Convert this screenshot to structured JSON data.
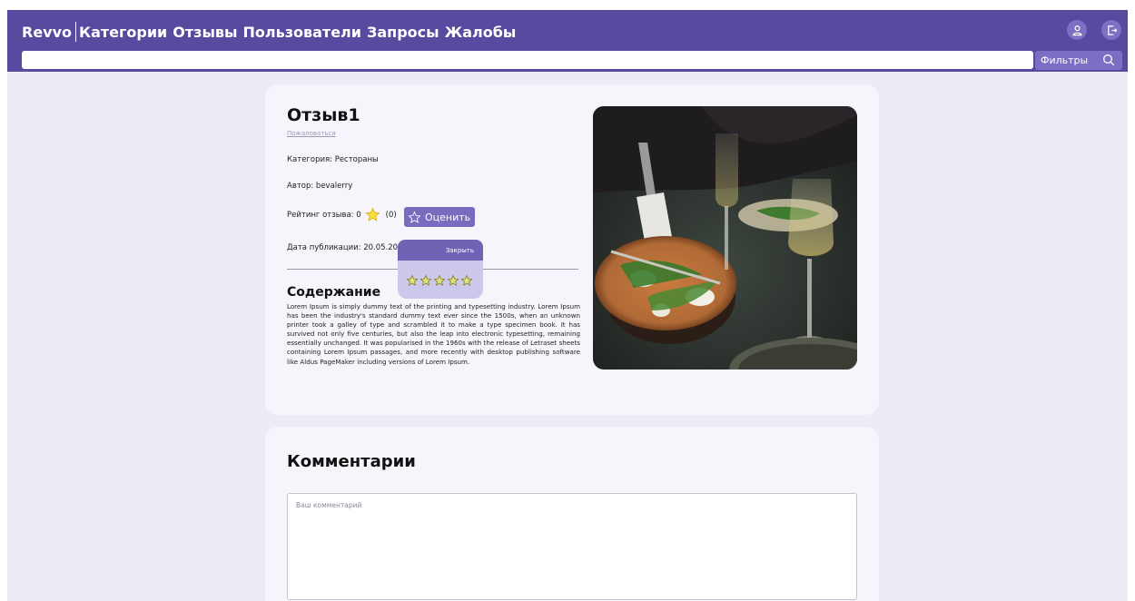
{
  "header": {
    "brand": "Revvo",
    "nav": [
      "Категории",
      "Отзывы",
      "Пользователи",
      "Запросы",
      "Жалобы"
    ],
    "icons": [
      "profile-icon",
      "logout-icon"
    ],
    "search_placeholder": "",
    "filters_label": "Фильтры"
  },
  "review": {
    "title": "Отзыв1",
    "complain": "Пожаловаться",
    "category": "Категория: Рестораны",
    "author": "Автор: bevalerry",
    "rating_label": "Рейтинг отзыва: 0",
    "rating_count": "(0)",
    "rate_button": "Оценить",
    "date": "Дата публикации: 20.05.202",
    "content_heading": "Содержание",
    "content_text": "Lorem Ipsum is simply dummy text of the printing and typesetting industry. Lorem Ipsum has been the industry's standard dummy text ever since the 1500s, when an unknown printer took a galley of type and scrambled it to make a type specimen book. It has survived not only five centuries, but also the leap into electronic typesetting, remaining essentially unchanged. It was popularised in the 1960s with the release of Letraset sheets containing Lorem Ipsum passages, and more recently with desktop publishing software like Aldus PageMaker including versions of Lorem Ipsum.",
    "image_description": "photo of pizza with arugula and wine glasses on a restaurant table"
  },
  "rating_popup": {
    "close_label": "Закрыть",
    "stars_total": 5,
    "stars_selected": 0
  },
  "comments": {
    "title": "Комментарии",
    "placeholder": "Ваш комментарий"
  },
  "colors": {
    "header_bg": "#574a9f",
    "page_bg": "#ecebf6",
    "card_bg": "#f6f5fc",
    "button_bg": "#776cbd",
    "popup_body": "#ccc8ec"
  }
}
